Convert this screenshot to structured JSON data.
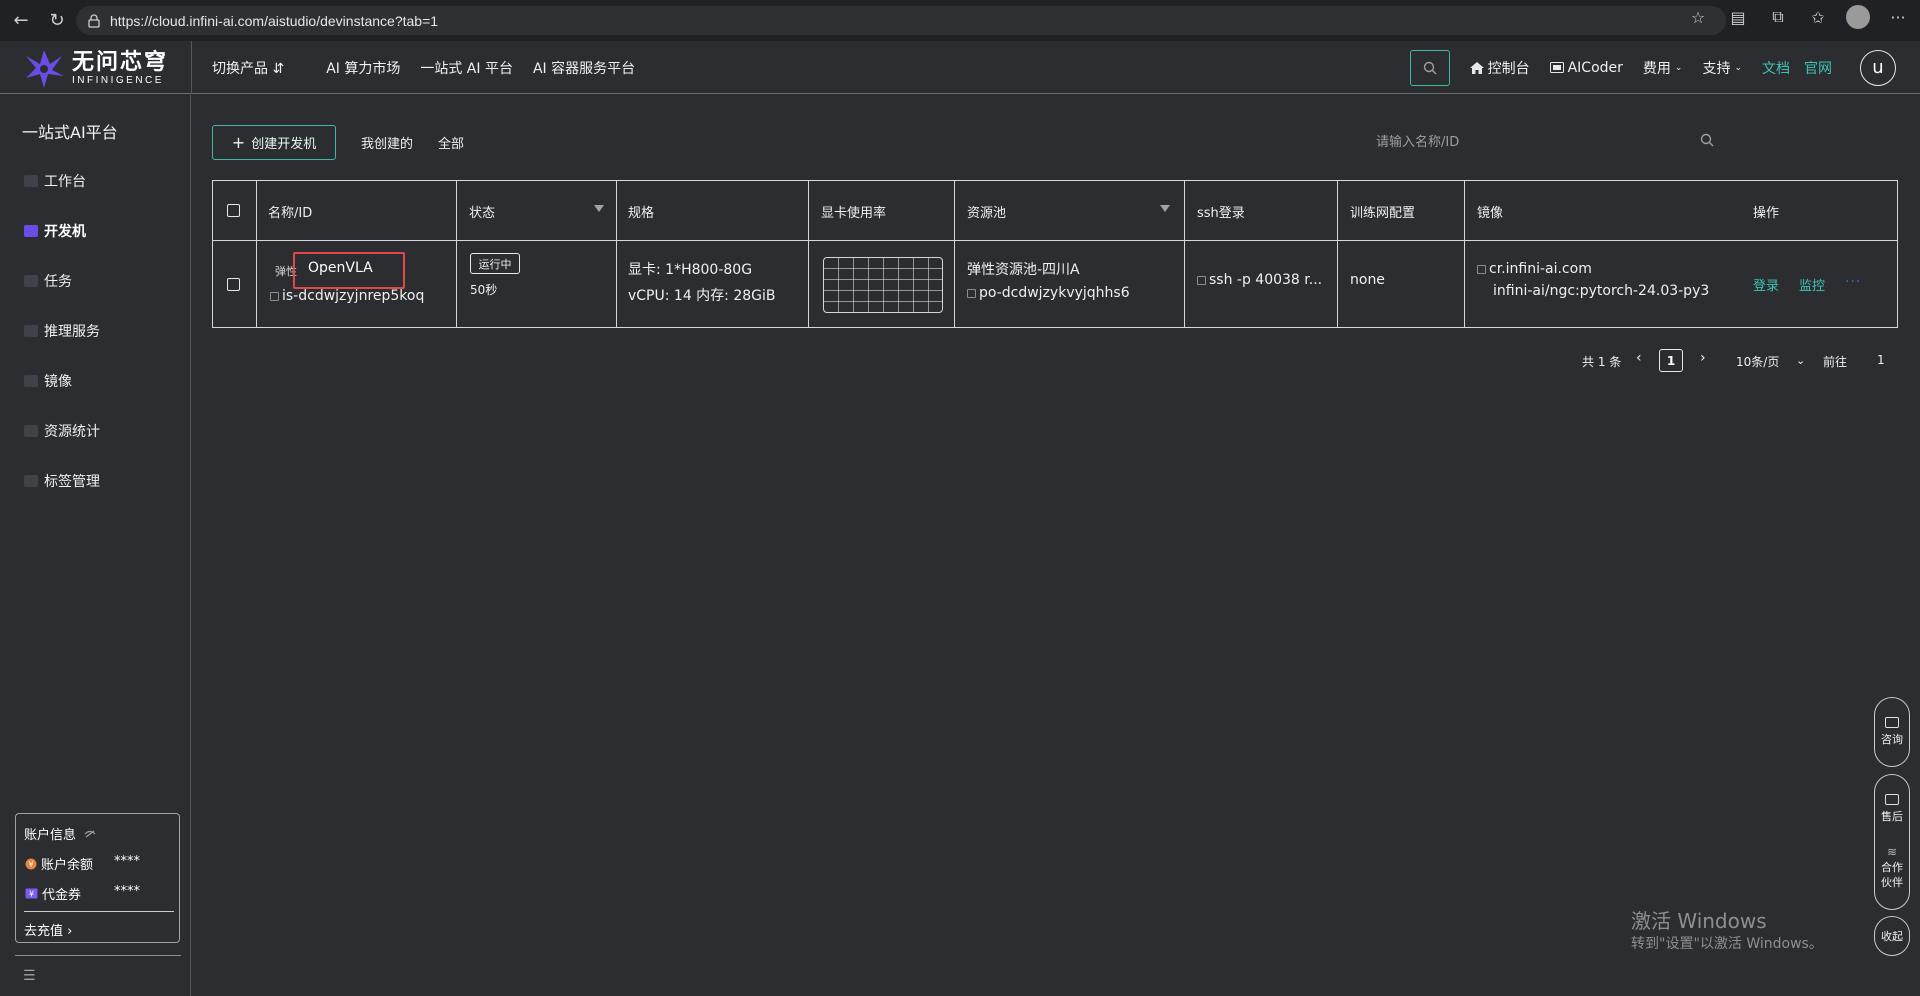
{
  "browser": {
    "url": "https://cloud.infini-ai.com/aistudio/devinstance?tab=1"
  },
  "header": {
    "logo_cn": "无问芯穹",
    "logo_en": "INFINIGENCE",
    "switch_product": "切换产品 ⇵",
    "nav": [
      "AI 算力市场",
      "一站式 AI 平台",
      "AI 容器服务平台"
    ],
    "console": "控制台",
    "aicoder": "AICoder",
    "fees": "费用",
    "support": "支持",
    "docs": "文档",
    "official_site": "官网",
    "avatar_letter": "u"
  },
  "sidebar": {
    "title": "一站式AI平台",
    "items": [
      {
        "label": "工作台",
        "active": false
      },
      {
        "label": "开发机",
        "active": true
      },
      {
        "label": "任务",
        "active": false
      },
      {
        "label": "推理服务",
        "active": false
      },
      {
        "label": "镜像",
        "active": false
      },
      {
        "label": "资源统计",
        "active": false
      },
      {
        "label": "标签管理",
        "active": false
      }
    ],
    "account": {
      "title": "账户信息",
      "balance_label": "账户余额",
      "balance_value": "****",
      "voucher_label": "代金券",
      "voucher_value": "****",
      "recharge": "去充值"
    }
  },
  "toolbar": {
    "create_label": "创建开发机",
    "tab_mine": "我创建的",
    "tab_all": "全部",
    "search_placeholder": "请输入名称/ID"
  },
  "table": {
    "headers": [
      "名称/ID",
      "状态",
      "规格",
      "显卡使用率",
      "资源池",
      "ssh登录",
      "训练网配置",
      "镜像",
      "操作"
    ],
    "row": {
      "tag": "弹性",
      "name": "OpenVLA",
      "id": "is-dcdwjzyjnrep5koq",
      "status": "运行中",
      "duration": "50秒",
      "spec_gpu": "显卡: 1*H800-80G",
      "spec_cpu": "vCPU: 14 内存: 28GiB",
      "pool_name": "弹性资源池-四川A",
      "pool_id": "po-dcdwjzykvyjqhhs6",
      "ssh": "ssh -p 40038 r...",
      "network": "none",
      "image_line1": "cr.infini-ai.com",
      "image_line2": "infini-ai/ngc:pytorch-24.03-py3",
      "action_login": "登录",
      "action_monitor": "监控",
      "action_more": "···"
    }
  },
  "pagination": {
    "total": "共 1 条",
    "current": "1",
    "page_size": "10条/页",
    "goto": "前往",
    "goto_value": "1"
  },
  "float": {
    "consult": "咨询",
    "after_sales": "售后",
    "partner": "合作伙伴",
    "collapse": "收起"
  },
  "watermark": {
    "line1": "激活 Windows",
    "line2": "转到\"设置\"以激活 Windows。"
  },
  "colors": {
    "accent": "#3fc3b3",
    "active_nav": "#6b4ce6",
    "highlight": "#e04848",
    "bg": "#2b2d31"
  }
}
